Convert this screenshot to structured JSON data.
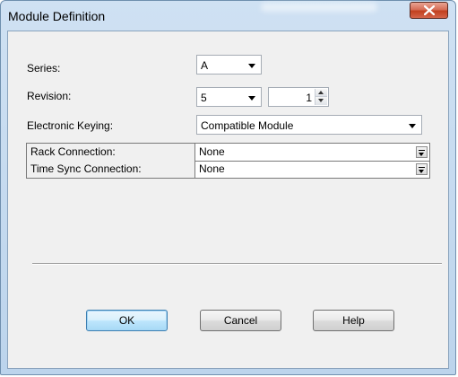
{
  "window": {
    "title": "Module Definition"
  },
  "form": {
    "series": {
      "label": "Series:",
      "value": "A"
    },
    "revision": {
      "label": "Revision:",
      "major": "5",
      "minor": "1"
    },
    "keying": {
      "label": "Electronic Keying:",
      "value": "Compatible Module"
    }
  },
  "grid": {
    "rows": [
      {
        "name": "Rack Connection:",
        "value": "None"
      },
      {
        "name": "Time Sync Connection:",
        "value": "None"
      }
    ]
  },
  "buttons": {
    "ok": "OK",
    "cancel": "Cancel",
    "help": "Help"
  },
  "colors": {
    "titlebar": "#bcd4ec",
    "close": "#c2401f",
    "client": "#f0f0f0",
    "default_button": "#bee6fd"
  },
  "icons": [
    "close-icon",
    "dropdown-arrow-icon",
    "spin-up-icon",
    "spin-down-icon"
  ]
}
